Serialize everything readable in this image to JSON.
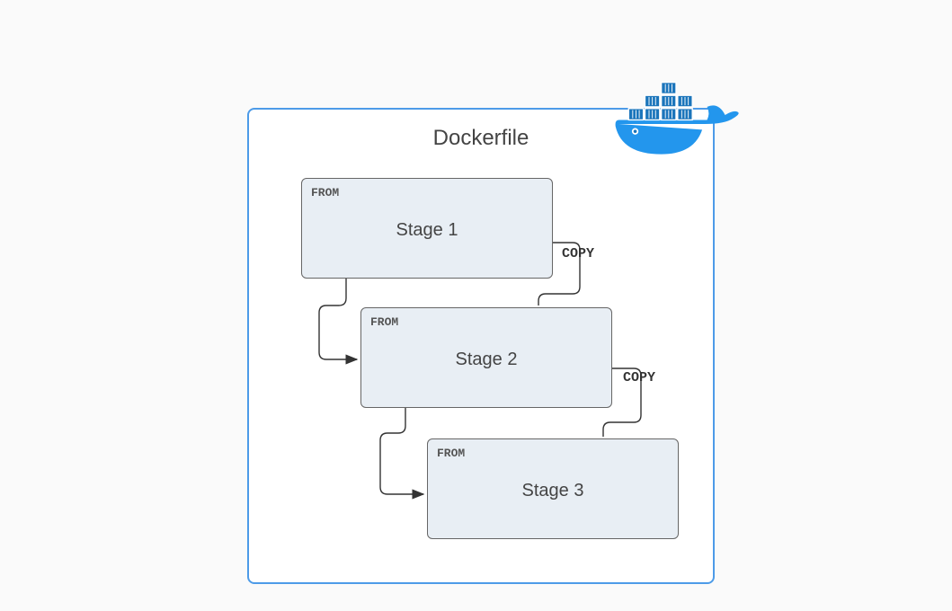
{
  "title": "Dockerfile",
  "stages": {
    "s1": {
      "keyword": "FROM",
      "label": "Stage 1"
    },
    "s2": {
      "keyword": "FROM",
      "label": "Stage 2"
    },
    "s3": {
      "keyword": "FROM",
      "label": "Stage 3"
    }
  },
  "copy": {
    "c1": "COPY",
    "c2": "COPY"
  },
  "colors": {
    "container_border": "#4d9be8",
    "stage_fill": "#e8eef4",
    "stage_border": "#666666",
    "docker_blue": "#2396ed",
    "docker_dark": "#1b75bb"
  },
  "logo": {
    "name": "docker-whale"
  }
}
